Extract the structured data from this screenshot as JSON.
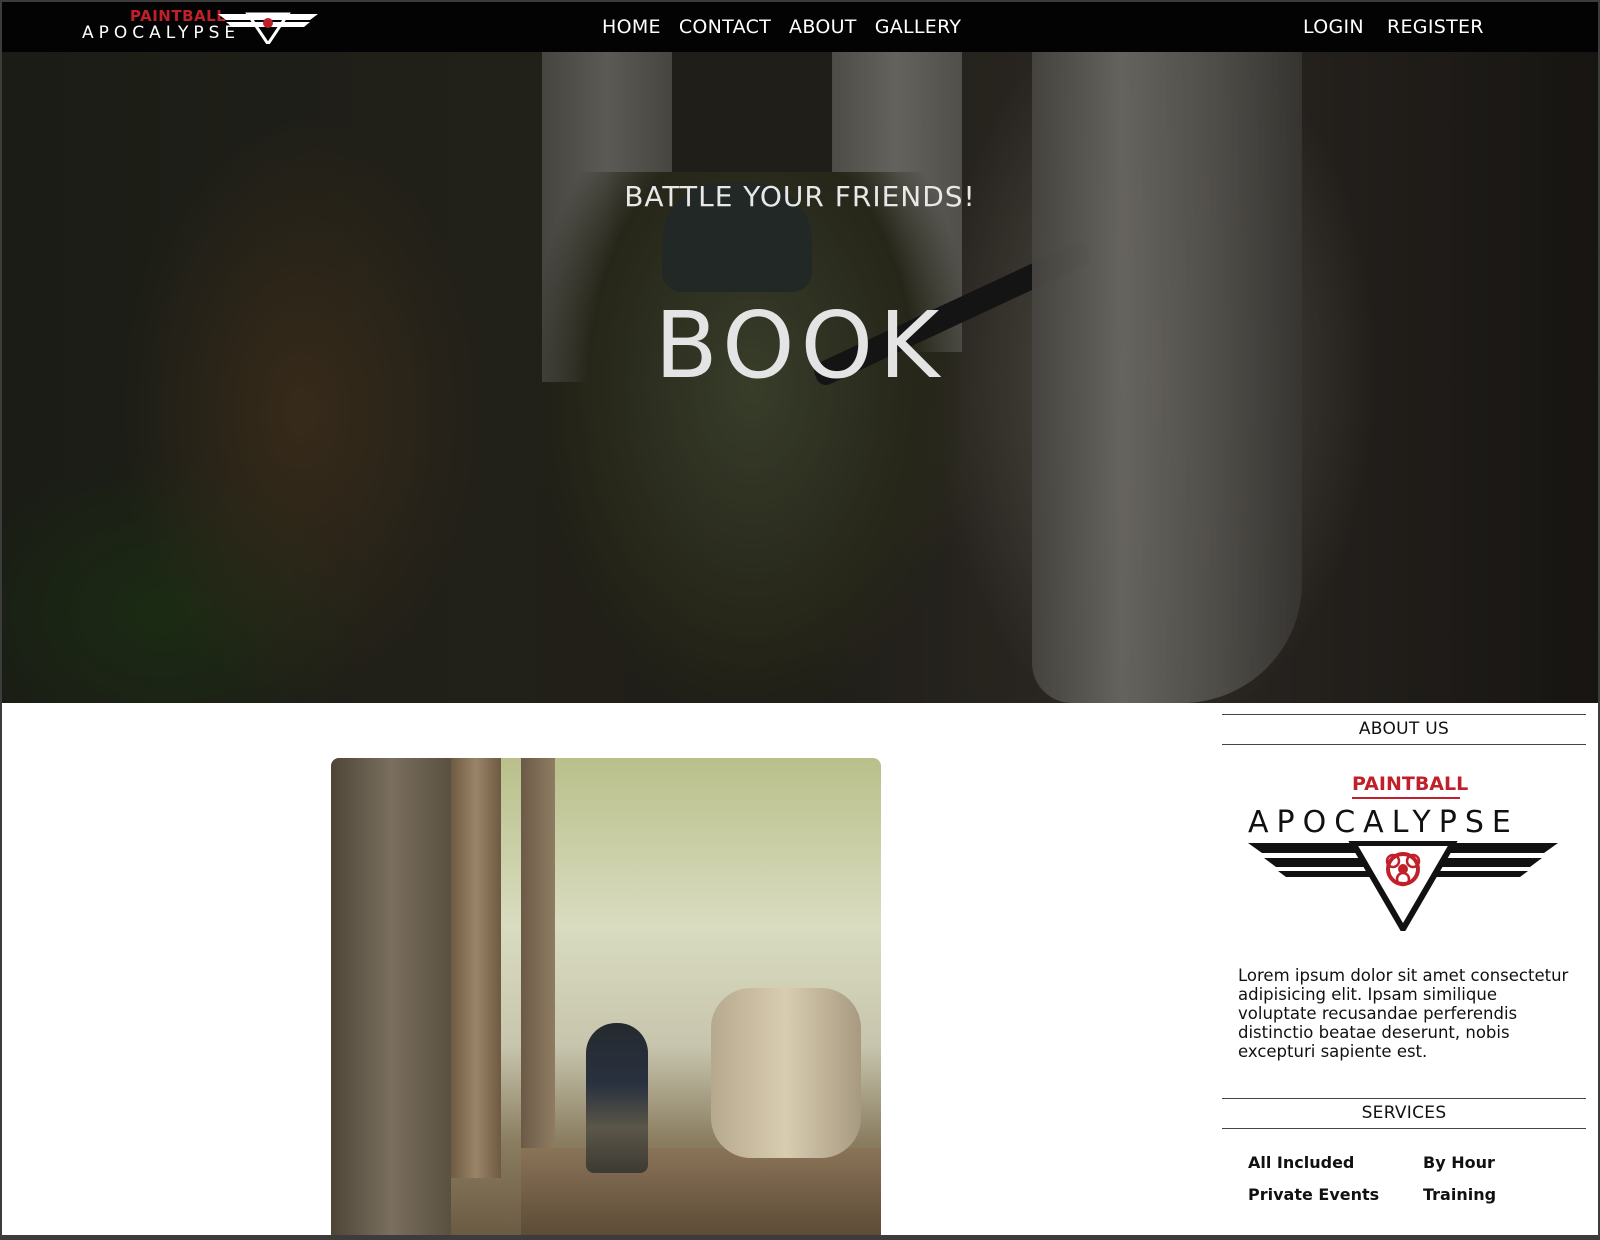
{
  "brand": {
    "logo_top": "PAINTBALL",
    "logo_main": "APOCALYPSE"
  },
  "nav": {
    "center": [
      "HOME",
      "CONTACT",
      "ABOUT",
      "GALLERY"
    ],
    "right": [
      "LOGIN",
      "REGISTER"
    ]
  },
  "hero": {
    "subtitle": "BATTLE YOUR FRIENDS!",
    "title": "BOOK"
  },
  "sidebar": {
    "about_title": "ABOUT US",
    "about_text": "Lorem ipsum dolor sit amet consectetur adipisicing elit. Ipsam similique voluptate recusandae perferendis distinctio beatae deserunt, nobis excepturi sapiente est.",
    "services_title": "SERVICES",
    "services": [
      "All Included",
      "By Hour",
      "Private Events",
      "Training"
    ]
  },
  "colors": {
    "navbar_bg": "#030303",
    "brand_red": "#c0202a",
    "text": "#111111"
  }
}
